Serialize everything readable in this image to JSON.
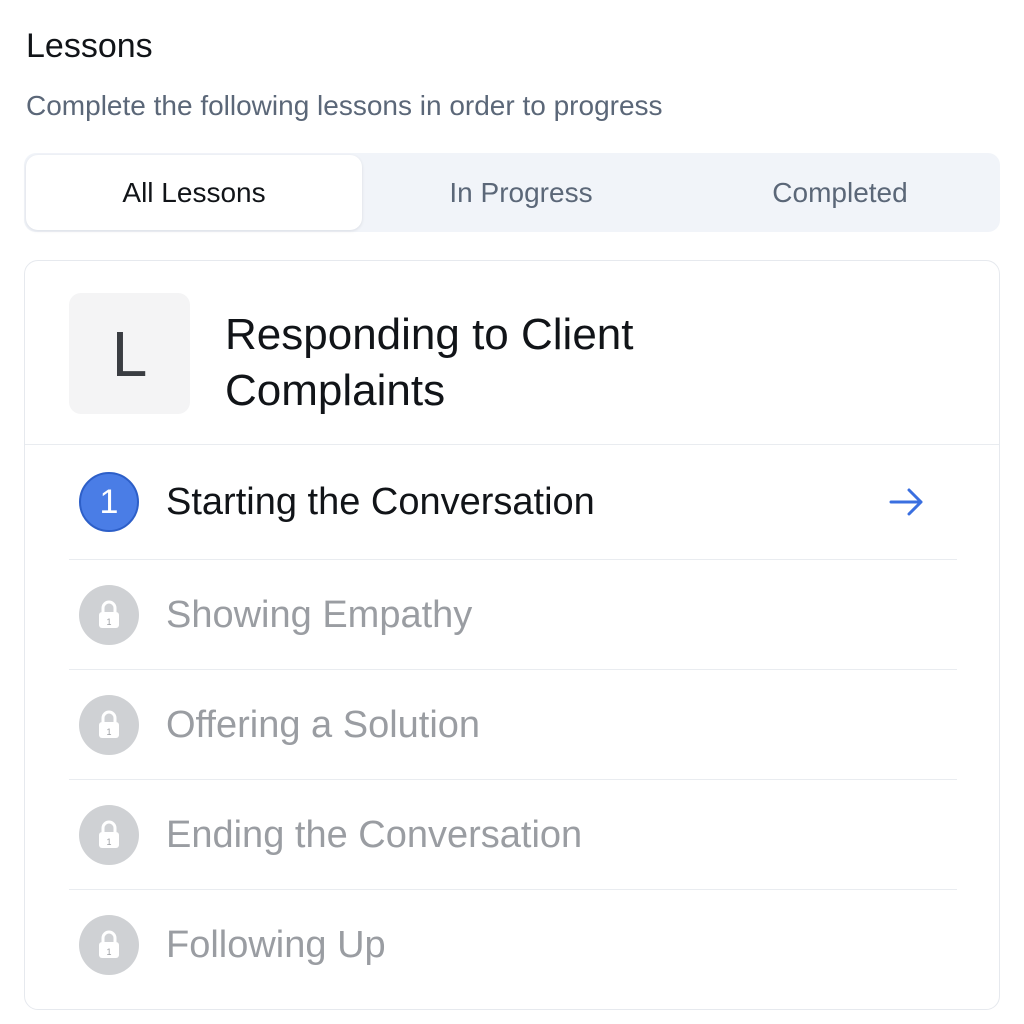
{
  "header": {
    "title": "Lessons",
    "subtitle": "Complete the following lessons in order to progress"
  },
  "tabs": [
    {
      "label": "All Lessons",
      "active": true
    },
    {
      "label": "In Progress",
      "active": false
    },
    {
      "label": "Completed",
      "active": false
    }
  ],
  "course": {
    "avatar_letter": "L",
    "title": "Responding to Client Complaints"
  },
  "lessons": [
    {
      "number": "1",
      "label": "Starting the Conversation",
      "status": "current",
      "icon": "arrow-right-icon"
    },
    {
      "lock_number": "1",
      "label": "Showing Empathy",
      "status": "locked",
      "icon": "lock-icon"
    },
    {
      "lock_number": "1",
      "label": "Offering a Solution",
      "status": "locked",
      "icon": "lock-icon"
    },
    {
      "lock_number": "1",
      "label": "Ending the Conversation",
      "status": "locked",
      "icon": "lock-icon"
    },
    {
      "lock_number": "1",
      "label": "Following Up",
      "status": "locked",
      "icon": "lock-icon"
    }
  ],
  "colors": {
    "accent": "#4a7de6",
    "arrow": "#3a6fe0",
    "locked_text": "#9a9da2",
    "locked_badge": "#cfd1d4",
    "subtitle": "#5b6778"
  }
}
